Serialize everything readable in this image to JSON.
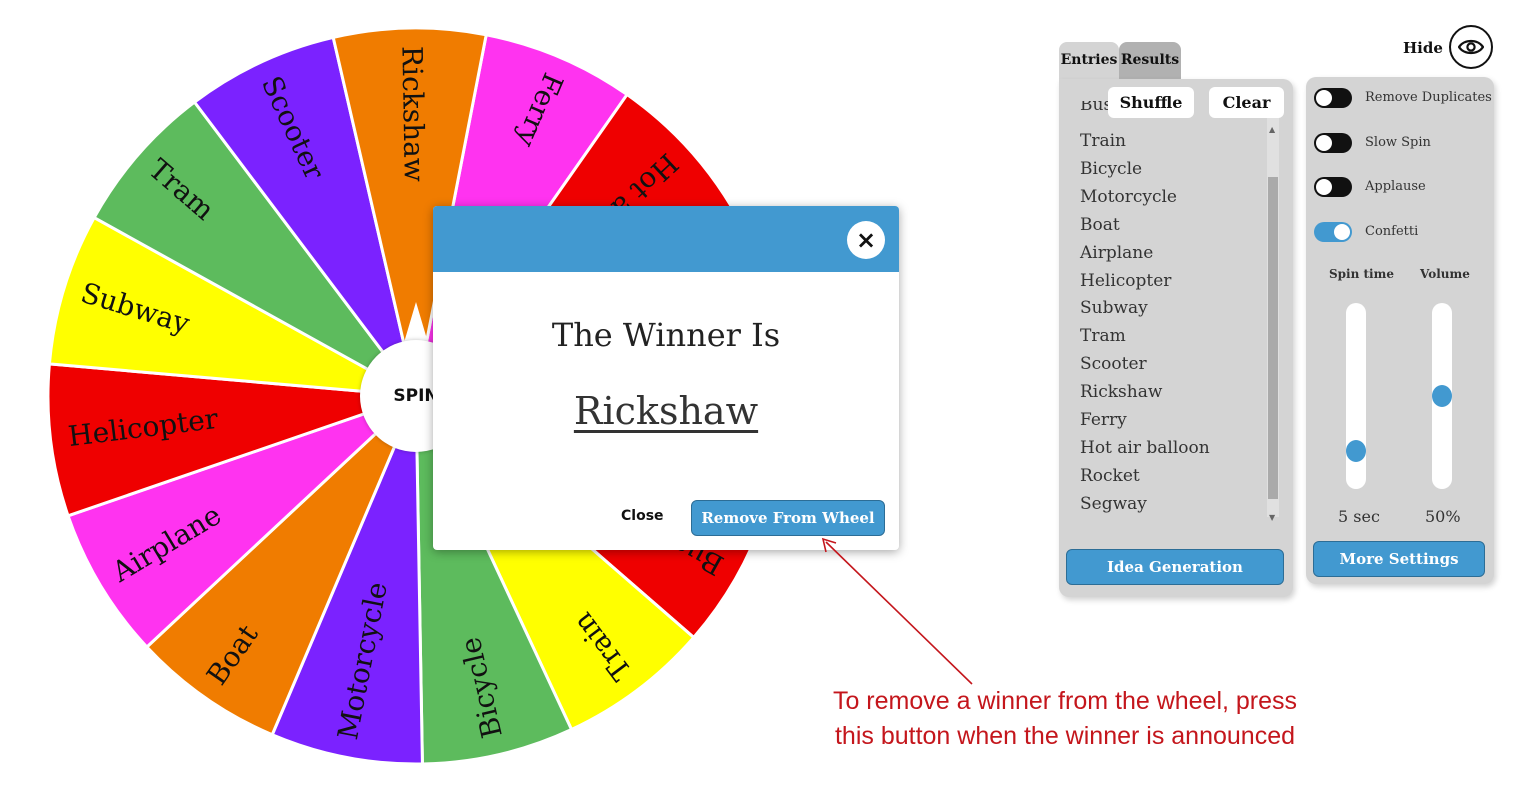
{
  "wheel": {
    "spin_label": "SPIN",
    "segments": [
      {
        "label": "Ferry",
        "color": "#ff33f0"
      },
      {
        "label": "Hot air balloon",
        "color": "#ef0000"
      },
      {
        "label": "Rocket",
        "color": "#ffff00"
      },
      {
        "label": "Segway",
        "color": "#5dbb5d"
      },
      {
        "label": "Bus",
        "color": "#ef0000"
      },
      {
        "label": "Train",
        "color": "#ffff00"
      },
      {
        "label": "Bicycle",
        "color": "#5dbb5d"
      },
      {
        "label": "Motorcycle",
        "color": "#7b22ff"
      },
      {
        "label": "Boat",
        "color": "#f07c00"
      },
      {
        "label": "Airplane",
        "color": "#ff33f0"
      },
      {
        "label": "Helicopter",
        "color": "#ef0000"
      },
      {
        "label": "Subway",
        "color": "#ffff00"
      },
      {
        "label": "Tram",
        "color": "#5dbb5d"
      },
      {
        "label": "Scooter",
        "color": "#7b22ff"
      },
      {
        "label": "Rickshaw",
        "color": "#f07c00"
      }
    ]
  },
  "modal": {
    "title": "The Winner Is",
    "winner": "Rickshaw",
    "close_icon": "×",
    "close_label": "Close",
    "remove_label": "Remove From Wheel"
  },
  "annotation": {
    "line1": "To remove a winner from the wheel, press",
    "line2": "this button when the winner is announced",
    "color": "#c4161c"
  },
  "top": {
    "hide_label": "Hide",
    "icon": "eye-icon"
  },
  "entries_panel": {
    "tabs": [
      "Entries",
      "Results"
    ],
    "shuffle_label": "Shuffle",
    "clear_label": "Clear",
    "partial_entry": "Bus",
    "entries": [
      "Train",
      "Bicycle",
      "Motorcycle",
      "Boat",
      "Airplane",
      "Helicopter",
      "Subway",
      "Tram",
      "Scooter",
      "Rickshaw",
      "Ferry",
      "Hot air balloon",
      "Rocket",
      "Segway"
    ],
    "idea_button": "Idea Generation"
  },
  "settings_panel": {
    "toggles": [
      {
        "label": "Remove Duplicates",
        "on": false
      },
      {
        "label": "Slow Spin",
        "on": false
      },
      {
        "label": "Applause",
        "on": false
      },
      {
        "label": "Confetti",
        "on": true
      }
    ],
    "spin_time_label": "Spin time",
    "volume_label": "Volume",
    "spin_time_value": "5 sec",
    "volume_value": "50%",
    "spin_time_level": 0.15,
    "volume_level": 0.5,
    "more_button": "More Settings"
  },
  "accent_color": "#4299d0"
}
